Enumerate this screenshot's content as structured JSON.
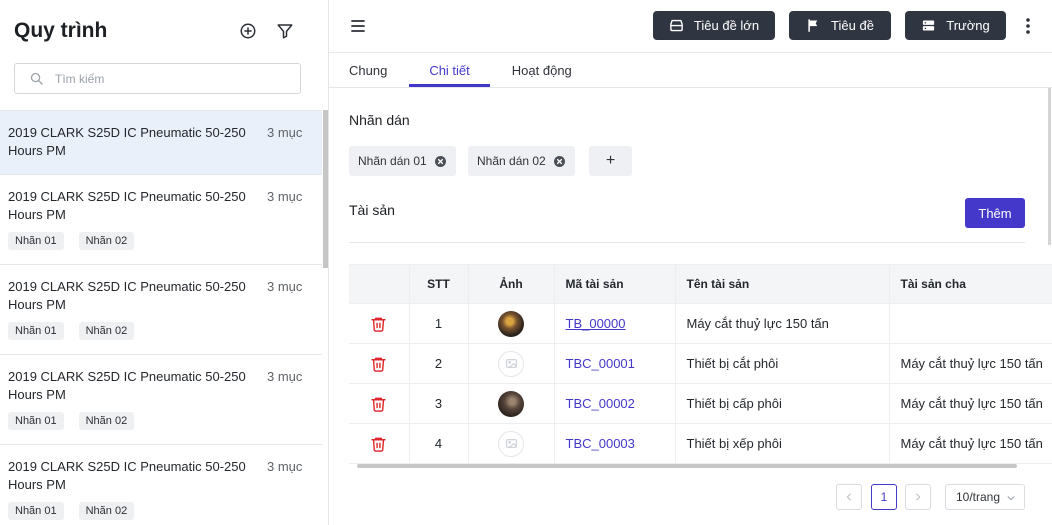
{
  "colors": {
    "accent": "#4338ca",
    "toolbar_button": "#2f3541",
    "delete": "#e0262b",
    "selected_item": "#eaf0fa"
  },
  "sidebar": {
    "title": "Quy trình",
    "add_icon": "plus-circle-icon",
    "filter_icon": "filter-icon",
    "search_icon": "search-icon",
    "search_placeholder": "Tìm kiếm",
    "items": [
      {
        "title": "2019 CLARK S25D IC Pneumatic 50-250 Hours PM",
        "count": "3 mục",
        "selected": true,
        "tags": []
      },
      {
        "title": "2019 CLARK S25D IC Pneumatic 50-250 Hours PM",
        "count": "3 mục",
        "selected": false,
        "tags": [
          "Nhãn 01",
          "Nhãn 02"
        ]
      },
      {
        "title": "2019 CLARK S25D IC Pneumatic 50-250 Hours PM",
        "count": "3 mục",
        "selected": false,
        "tags": [
          "Nhãn 01",
          "Nhãn 02"
        ]
      },
      {
        "title": "2019 CLARK S25D IC Pneumatic 50-250 Hours PM",
        "count": "3 mục",
        "selected": false,
        "tags": [
          "Nhãn 01",
          "Nhãn 02"
        ]
      },
      {
        "title": "2019 CLARK S25D IC Pneumatic 50-250 Hours PM",
        "count": "3 mục",
        "selected": false,
        "tags": [
          "Nhãn 01",
          "Nhãn 02"
        ]
      }
    ]
  },
  "toolbar": {
    "menu_icon": "hamburger-icon",
    "buttons": [
      {
        "label": "Tiêu đề lớn",
        "icon": "archive-icon"
      },
      {
        "label": "Tiêu đề",
        "icon": "flag-icon"
      },
      {
        "label": "Trường",
        "icon": "server-icon"
      }
    ],
    "more_icon": "kebab-icon"
  },
  "tabs": [
    {
      "label": "Chung",
      "active": false
    },
    {
      "label": "Chi tiết",
      "active": true
    },
    {
      "label": "Hoạt động",
      "active": false
    }
  ],
  "labels": {
    "title": "Nhãn dán",
    "chips": [
      "Nhãn dán 01",
      "Nhãn dán 02"
    ],
    "remove_icon": "x-circle-icon",
    "add_label": "+"
  },
  "assets": {
    "title": "Tài sản",
    "add_button": "Thêm",
    "columns": {
      "stt": "STT",
      "image": "Ảnh",
      "code": "Mã tài sản",
      "name": "Tên tài sản",
      "parent": "Tài sản cha"
    },
    "delete_icon": "trash-icon",
    "rows": [
      {
        "stt": "1",
        "image": "photo-thumbnail",
        "code": "TB_00000",
        "name": "Máy cắt thuỷ lực 150 tấn",
        "parent": ""
      },
      {
        "stt": "2",
        "image": "image-placeholder-icon",
        "code": "TBC_00001",
        "name": "Thiết bị cắt phôi",
        "parent": "Máy cắt thuỷ lực 150 tấn"
      },
      {
        "stt": "3",
        "image": "photo-thumbnail",
        "code": "TBC_00002",
        "name": "Thiết bị cấp phôi",
        "parent": "Máy cắt thuỷ lực 150 tấn"
      },
      {
        "stt": "4",
        "image": "image-placeholder-icon",
        "code": "TBC_00003",
        "name": "Thiết bị xếp phôi",
        "parent": "Máy cắt thuỷ lực 150 tấn"
      }
    ]
  },
  "pagination": {
    "prev_icon": "chevron-left-icon",
    "current_page": "1",
    "next_icon": "chevron-right-icon",
    "page_size": "10/trang",
    "dropdown_icon": "chevron-down-icon"
  }
}
